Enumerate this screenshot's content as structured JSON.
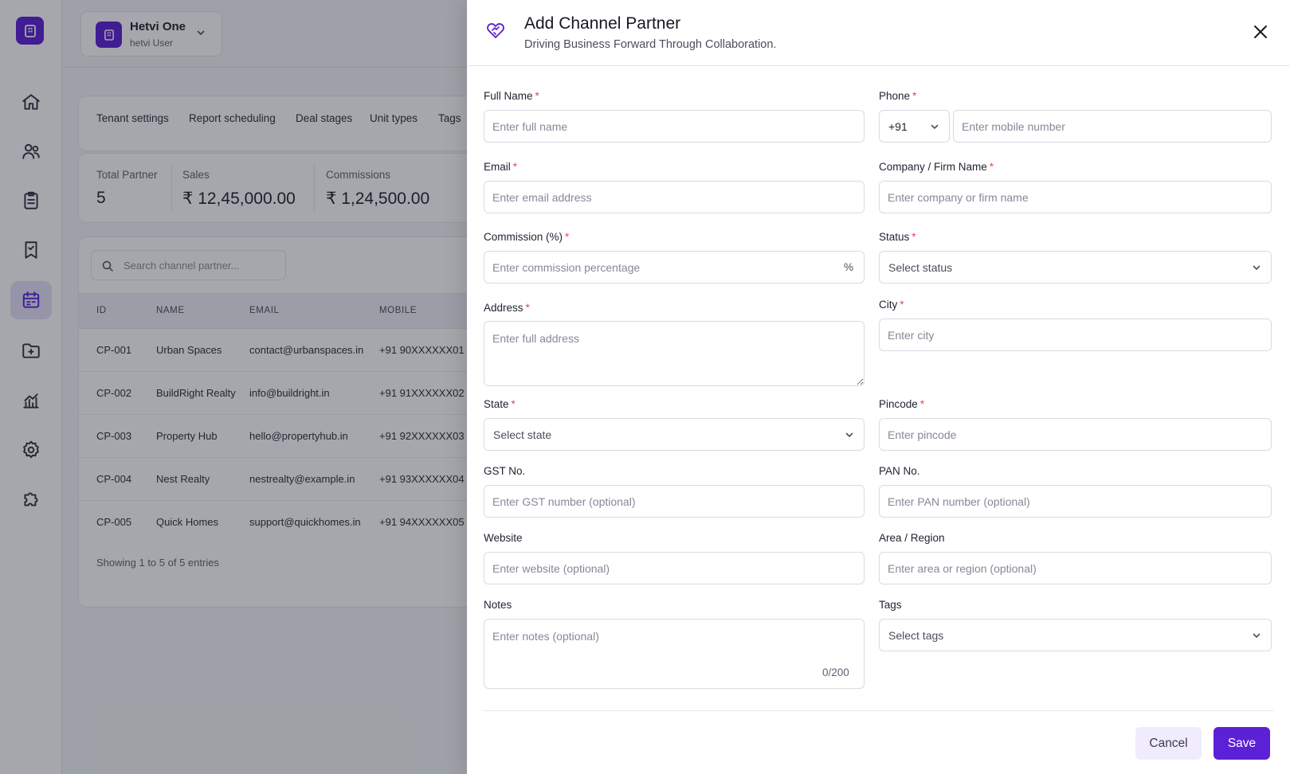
{
  "colors": {
    "accent": "#5b21d6",
    "required": "#e0485b"
  },
  "tenant": {
    "name": "Hetvi One",
    "role": "hetvi User"
  },
  "rail": {
    "icons": [
      "home-icon",
      "users-icon",
      "clipboard-icon",
      "bookmark-icon",
      "calendar-icon",
      "folder-icon",
      "chart-icon",
      "settings-icon",
      "puzzle-icon"
    ],
    "active": "calendar-icon"
  },
  "tabs": [
    "Tenant settings",
    "Report scheduling",
    "Deal stages",
    "Unit types",
    "Tags"
  ],
  "stats": [
    {
      "label": "Total Partner",
      "value": "5"
    },
    {
      "label": "Sales",
      "value": "₹ 12,45,000.00"
    },
    {
      "label": "Commissions",
      "value": "₹ 1,24,500.00"
    }
  ],
  "table": {
    "search_placeholder": "Search channel partner...",
    "columns": [
      "ID",
      "NAME",
      "EMAIL",
      "MOBILE"
    ],
    "rows": [
      {
        "id": "CP-001",
        "name": "Urban Spaces",
        "email": "contact@urbanspaces.in",
        "mobile": "+91 90XXXXXX01"
      },
      {
        "id": "CP-002",
        "name": "BuildRight Realty",
        "email": "info@buildright.in",
        "mobile": "+91 91XXXXXX02"
      },
      {
        "id": "CP-003",
        "name": "Property Hub",
        "email": "hello@propertyhub.in",
        "mobile": "+91 92XXXXXX03"
      },
      {
        "id": "CP-004",
        "name": "Nest Realty",
        "email": "nestrealty@example.in",
        "mobile": "+91 93XXXXXX04"
      },
      {
        "id": "CP-005",
        "name": "Quick Homes",
        "email": "support@quickhomes.in",
        "mobile": "+91 94XXXXXX05"
      }
    ],
    "footer": "Showing 1 to 5 of 5 entries"
  },
  "drawer": {
    "title": "Add Channel Partner",
    "subtitle": "Driving Business Forward Through Collaboration.",
    "required_mark": "*",
    "fields": {
      "full_name": {
        "label": "Full Name",
        "placeholder": "Enter full name"
      },
      "phone": {
        "label": "Phone",
        "country_code": "+91",
        "placeholder": "Enter mobile number"
      },
      "email": {
        "label": "Email",
        "placeholder": "Enter email address"
      },
      "company": {
        "label": "Company / Firm Name",
        "placeholder": "Enter company or firm name"
      },
      "commission": {
        "label": "Commission (%)",
        "placeholder": "Enter commission percentage",
        "suffix": "%"
      },
      "status": {
        "label": "Status",
        "placeholder": "Select status"
      },
      "address": {
        "label": "Address",
        "placeholder": "Enter full address"
      },
      "city": {
        "label": "City",
        "placeholder": "Enter city"
      },
      "state": {
        "label": "State",
        "placeholder": "Select state"
      },
      "pincode": {
        "label": "Pincode",
        "placeholder": "Enter pincode"
      },
      "gst": {
        "label": "GST No.",
        "placeholder": "Enter GST number (optional)"
      },
      "pan": {
        "label": "PAN No.",
        "placeholder": "Enter PAN number (optional)"
      },
      "website": {
        "label": "Website",
        "placeholder": "Enter website (optional)"
      },
      "area": {
        "label": "Area / Region",
        "placeholder": "Enter area or region (optional)"
      },
      "notes": {
        "label": "Notes",
        "placeholder": "Enter notes (optional)",
        "counter": "0/200"
      },
      "tags": {
        "label": "Tags",
        "placeholder": "Select tags"
      }
    },
    "cancel_label": "Cancel",
    "save_label": "Save"
  }
}
